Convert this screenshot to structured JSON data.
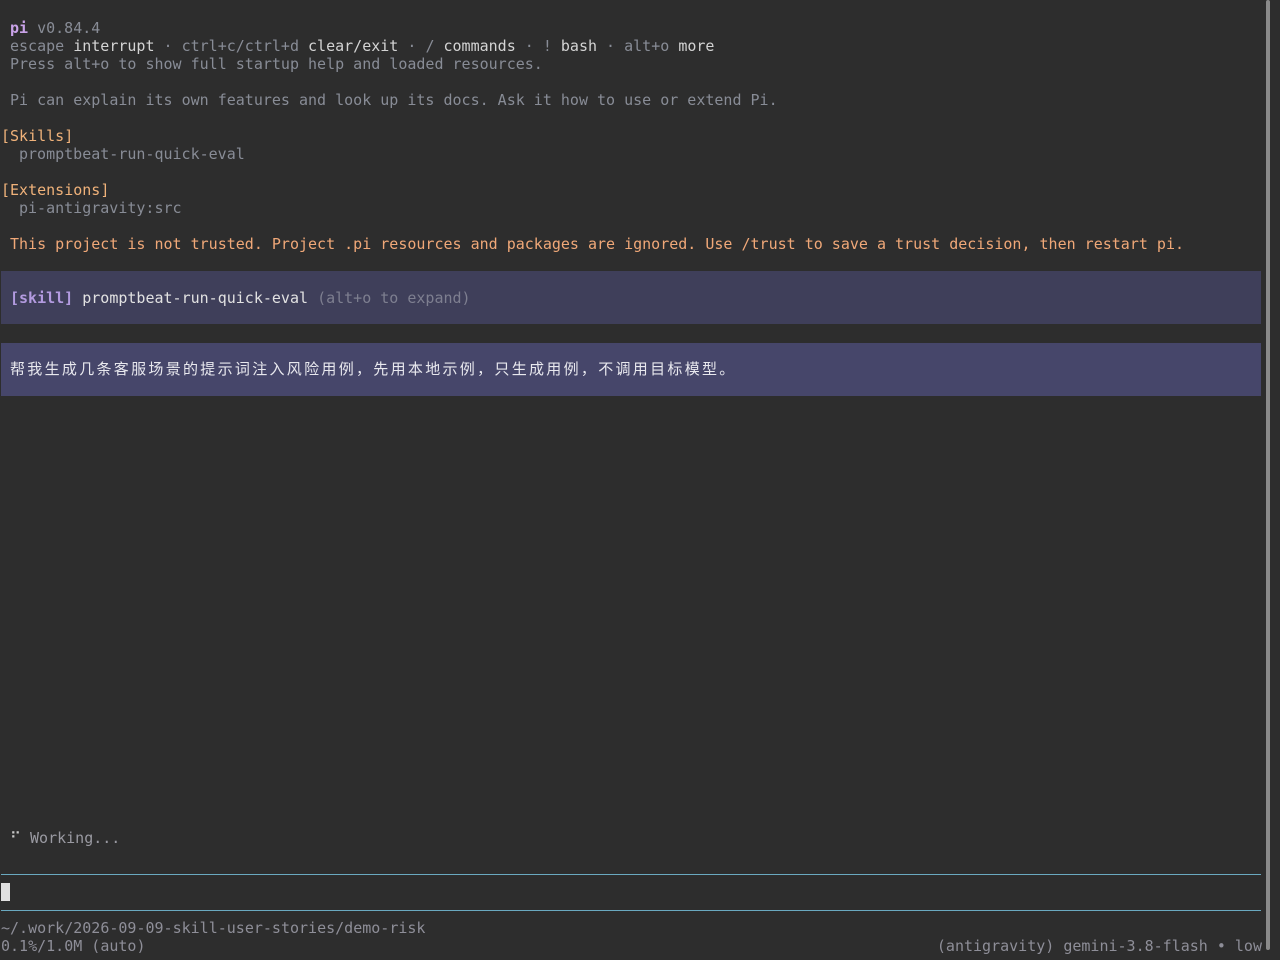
{
  "header": {
    "app_name": "pi",
    "version": "v0.84.4"
  },
  "shortcuts": {
    "escape_key": "escape",
    "escape_action": "interrupt",
    "sep": " · ",
    "clear_key": "ctrl+c/ctrl+d",
    "clear_action": "clear/exit",
    "commands_key": "/",
    "commands_action": "commands",
    "bash_key": "!",
    "bash_action": "bash",
    "more_key": "alt+o",
    "more_action": "more"
  },
  "startup_hint": "Press alt+o to show full startup help and loaded resources.",
  "intro": "Pi can explain its own features and look up its docs. Ask it how to use or extend Pi.",
  "skills": {
    "heading": "[Skills]",
    "items": [
      "promptbeat-run-quick-eval"
    ]
  },
  "extensions": {
    "heading": "[Extensions]",
    "items": [
      "pi-antigravity:src"
    ]
  },
  "trust_warning": "This project is not trusted. Project .pi resources and packages are ignored. Use /trust to save a trust decision, then restart pi.",
  "skill_block": {
    "tag": "[skill]",
    "name": "promptbeat-run-quick-eval",
    "hint": "(alt+o to expand)"
  },
  "user_message": "帮我生成几条客服场景的提示词注入风险用例，先用本地示例，只生成用例，不调用目标模型。",
  "status": {
    "spinner": "⠋",
    "text": "Working..."
  },
  "footer": {
    "path": "~/.work/2026-09-09-skill-user-stories/demo-risk",
    "usage": "0.1%/1.0M (auto)",
    "model": "(antigravity) gemini-3.8-flash • low"
  },
  "colors": {
    "background": "#2d2d2d",
    "accent": "#c9a2e8",
    "section": "#f0b27a",
    "warning": "#f0a878",
    "skill_box": "#3f3f5a",
    "user_box": "#46466a",
    "divider": "#6aa9c0"
  }
}
